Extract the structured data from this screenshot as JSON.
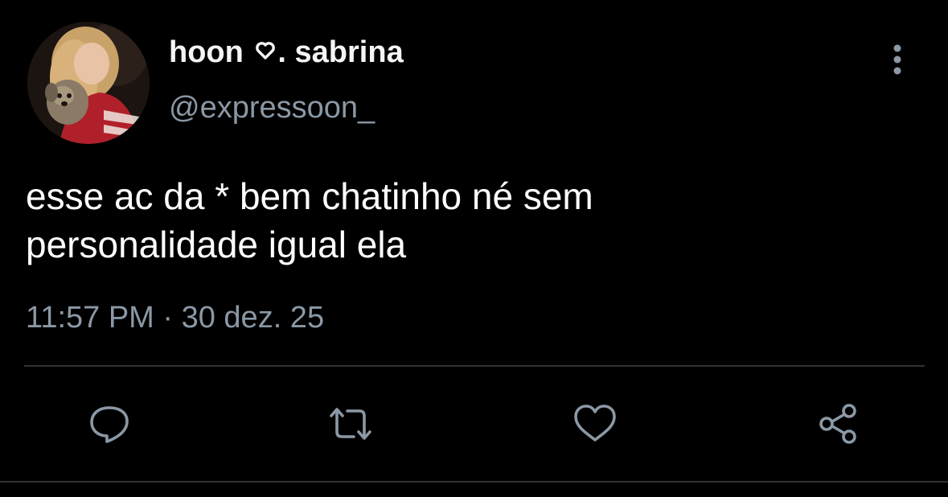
{
  "user": {
    "display_name_left": "hoon",
    "display_name_right": ". sabrina",
    "handle": "@expressoon_"
  },
  "tweet": {
    "text_line1": "esse ac da * bem chatinho né sem",
    "text_line2": "personalidade igual ela",
    "timestamp": "11:57 PM · 30 dez. 25"
  },
  "icons": {
    "more": "more-vertical-icon",
    "reply": "reply-bubble-icon",
    "retweet": "retweet-icon",
    "like": "heart-icon",
    "share": "share-icon"
  },
  "colors": {
    "background": "#000000",
    "text": "#ffffff",
    "muted": "#8b98a5",
    "divider": "#2f3336"
  }
}
